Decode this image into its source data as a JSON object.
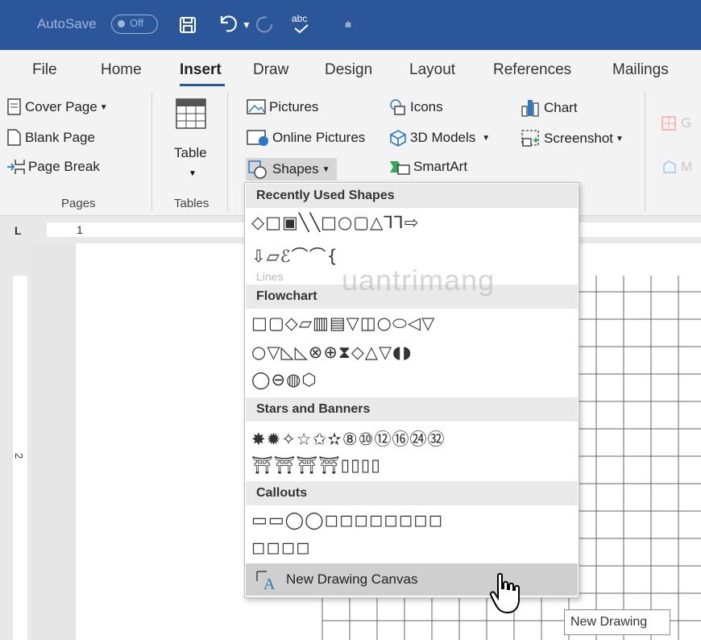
{
  "titlebar": {
    "autosave_label": "AutoSave",
    "autosave_state": "Off",
    "icons": [
      "save-icon",
      "undo-icon",
      "redo-icon",
      "spelling-icon",
      "customize-qat-icon"
    ],
    "spelling_text": "abc"
  },
  "tabs": [
    "File",
    "Home",
    "Insert",
    "Draw",
    "Design",
    "Layout",
    "References",
    "Mailings"
  ],
  "active_tab": "Insert",
  "ribbon": {
    "pages": {
      "cover_page": "Cover Page",
      "blank_page": "Blank Page",
      "page_break": "Page Break",
      "label": "Pages"
    },
    "tables": {
      "table": "Table",
      "label": "Tables"
    },
    "illustrations": {
      "pictures": "Pictures",
      "online_pictures": "Online Pictures",
      "shapes": "Shapes",
      "icons": "Icons",
      "models_3d": "3D Models",
      "smartart": "SmartArt",
      "chart": "Chart",
      "screenshot": "Screenshot"
    },
    "partial": {
      "get_addins": "G",
      "my_addins": "M"
    }
  },
  "ruler": {
    "mark_1": "1",
    "mark_2": "2",
    "tab_selector": "L"
  },
  "shapes_menu": {
    "recently_used": {
      "title": "Recently Used Shapes",
      "row1": "◇□▣╲╲□○▢△⅂⅂⇨",
      "row2": "⇩▱ℰ⌒⌒{"
    },
    "lines": {
      "title": "Lines"
    },
    "flowchart": {
      "title": "Flowchart",
      "row1": "□▢◇▱▥▤▽◫○⬭◁▽",
      "row2": "○▽◺◺⊗⊕⧗◇△▽◖◗",
      "row3": "◯⊖◍⬡"
    },
    "stars": {
      "title": "Stars and Banners",
      "row1": "✸✹✧☆✩✫⑧⑩⑫⑯㉔㉜",
      "row2": "⛩⛩⛩⛩▯▯▯▯"
    },
    "callouts": {
      "title": "Callouts",
      "row1": "▭▭◯◯◻◻◻◻◻◻◻◻",
      "row2": "◻◻◻◻"
    },
    "new_canvas": "New Drawing Canvas"
  },
  "tooltip": "New Drawing",
  "watermark": "uantrimang"
}
